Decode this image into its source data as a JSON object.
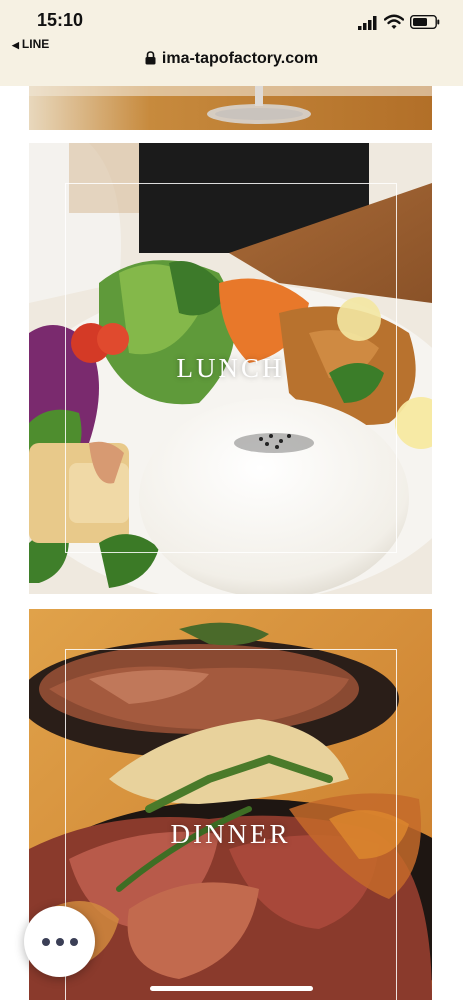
{
  "status_bar": {
    "time": "15:10",
    "back_app": "LINE",
    "url": "ima-tapofactory.com"
  },
  "sections": [
    {
      "label": "LUNCH"
    },
    {
      "label": "DINNER"
    }
  ],
  "colors": {
    "status_bg": "#f6f1e3",
    "menu_dots": "#3b3f56"
  },
  "icons": {
    "signal": "cellular-signal-icon",
    "wifi": "wifi-icon",
    "battery": "battery-icon",
    "lock": "lock-icon",
    "more": "more-dots-icon"
  }
}
